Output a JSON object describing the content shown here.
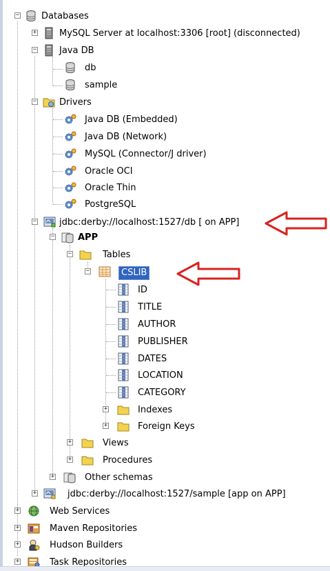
{
  "tree": {
    "databases": "Databases",
    "mysql_server": "MySQL Server at localhost:3306 [root] (disconnected)",
    "java_db": "Java DB",
    "db": "db",
    "sample": "sample",
    "drivers": "Drivers",
    "driver_items": [
      "Java DB (Embedded)",
      "Java DB (Network)",
      "MySQL (Connector/J driver)",
      "Oracle OCI",
      "Oracle Thin",
      "PostgreSQL"
    ],
    "conn_db": "jdbc:derby://localhost:1527/db [ on APP]",
    "app": "APP",
    "tables": "Tables",
    "cslib": "CSLIB",
    "columns": [
      "ID",
      "TITLE",
      "AUTHOR",
      "PUBLISHER",
      "DATES",
      "LOCATION",
      "CATEGORY"
    ],
    "indexes": "Indexes",
    "foreign_keys": "Foreign Keys",
    "views": "Views",
    "procedures": "Procedures",
    "other_schemas": "Other schemas",
    "conn_sample": "jdbc:derby://localhost:1527/sample [app on APP]",
    "web_services": "Web Services",
    "maven_repos": "Maven Repositories",
    "hudson_builders": "Hudson Builders",
    "task_repos": "Task Repositories"
  },
  "colors": {
    "selection": "#2f64c0",
    "annotation_arrow": "#d9221f",
    "folder": "#f3d34e"
  }
}
